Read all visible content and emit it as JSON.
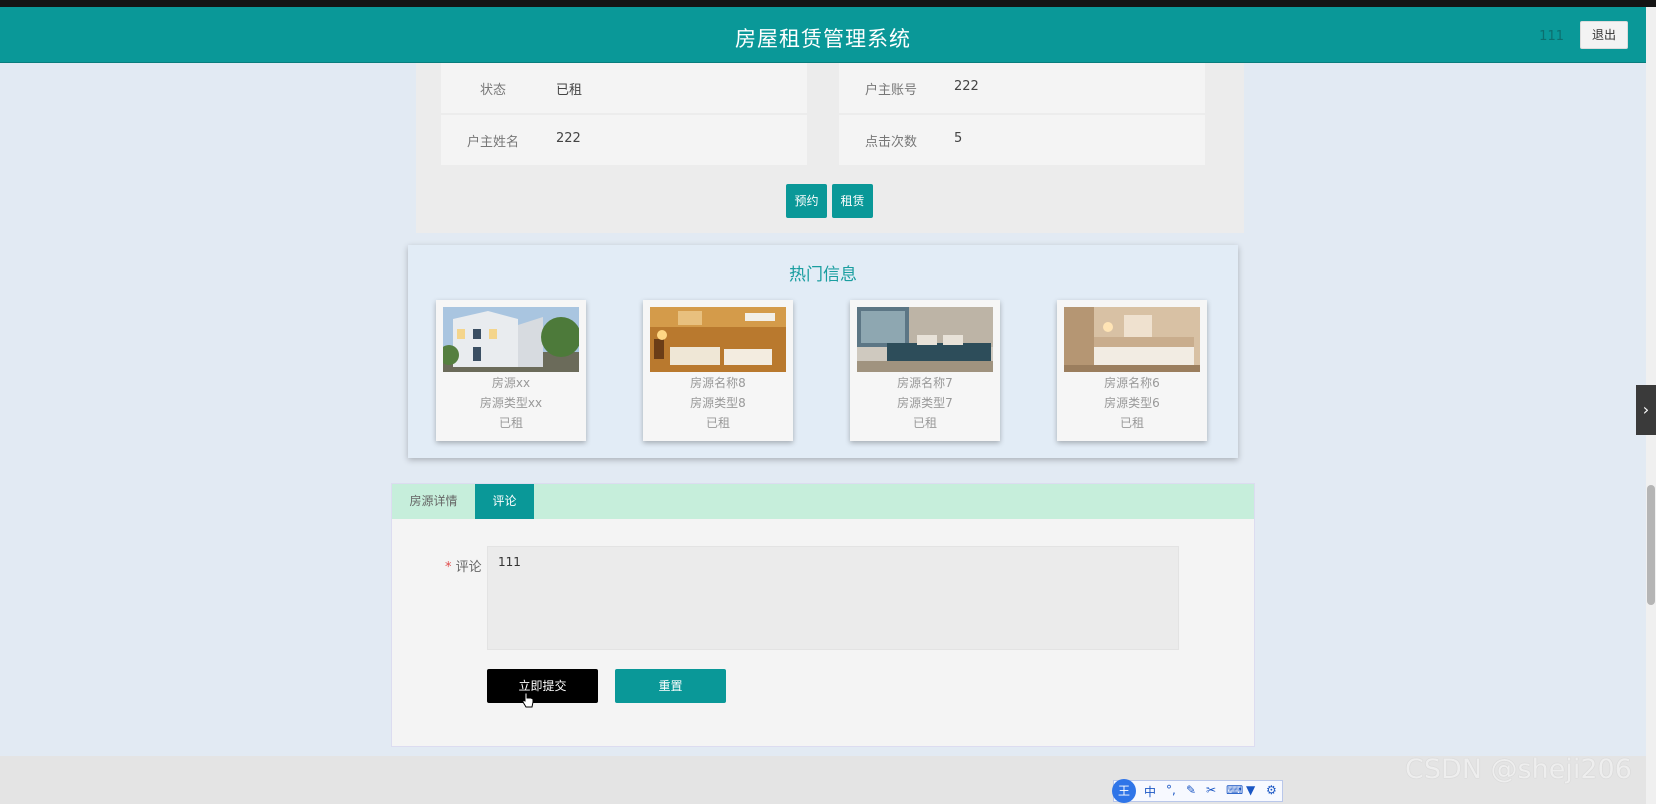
{
  "header": {
    "title": "房屋租赁管理系统",
    "user": "111",
    "logout_label": "退出"
  },
  "detail": {
    "fields": [
      {
        "label": "状态",
        "value": "已租"
      },
      {
        "label": "户主账号",
        "value": "222"
      },
      {
        "label": "户主姓名",
        "value": "222"
      },
      {
        "label": "点击次数",
        "value": "5"
      }
    ],
    "reserve_label": "预约",
    "rent_label": "租赁"
  },
  "hot": {
    "title": "热门信息",
    "cards": [
      {
        "name": "房源xx",
        "type": "房源类型xx",
        "status": "已租"
      },
      {
        "name": "房源名称8",
        "type": "房源类型8",
        "status": "已租"
      },
      {
        "name": "房源名称7",
        "type": "房源类型7",
        "status": "已租"
      },
      {
        "name": "房源名称6",
        "type": "房源类型6",
        "status": "已租"
      }
    ]
  },
  "tabs": [
    {
      "label": "房源详情"
    },
    {
      "label": "评论"
    }
  ],
  "comment": {
    "required_mark": "*",
    "label": "评论",
    "value": "111",
    "submit_label": "立即提交",
    "reset_label": "重置"
  },
  "ime": {
    "logo": "王",
    "mode": "中"
  },
  "watermark": "CSDN @sheji206",
  "colors": {
    "primary": "#0a9898",
    "tab_bar": "#c6eedb",
    "background": "#e2eaf3"
  }
}
